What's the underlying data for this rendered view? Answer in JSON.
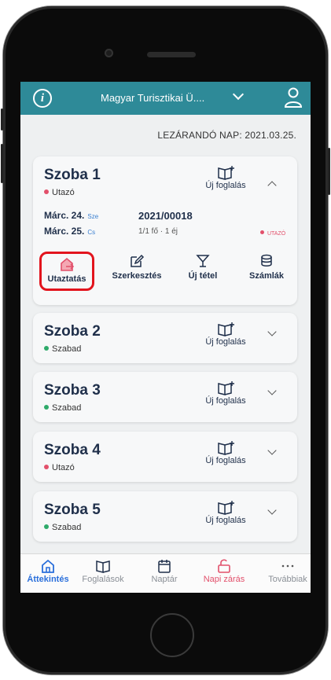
{
  "header": {
    "org_name": "Magyar Turisztikai Ü....",
    "colors": {
      "header_bg": "#2e8a98"
    }
  },
  "close_day": "LEZÁRANDÓ NAP: 2021.03.25.",
  "rooms": [
    {
      "name": "Szoba 1",
      "status": "Utazó",
      "status_color": "#e2506b",
      "booking_label": "Új foglalás",
      "expanded": true,
      "details": {
        "arrival_date": "Márc. 24.",
        "arrival_day": "Sze",
        "departure_date": "Márc. 25.",
        "departure_day": "Cs",
        "booking_number": "2021/00018",
        "guests_nights": "1/1 fő · 1 éj",
        "badge": "UTAZÓ"
      },
      "actions": [
        {
          "label": "Utaztatás",
          "icon": "house-exit-icon",
          "highlighted": true
        },
        {
          "label": "Szerkesztés",
          "icon": "edit-icon"
        },
        {
          "label": "Új tétel",
          "icon": "cocktail-icon"
        },
        {
          "label": "Számlák",
          "icon": "coins-icon"
        }
      ]
    },
    {
      "name": "Szoba 2",
      "status": "Szabad",
      "status_color": "#2eaa6a",
      "booking_label": "Új foglalás"
    },
    {
      "name": "Szoba 3",
      "status": "Szabad",
      "status_color": "#2eaa6a",
      "booking_label": "Új foglalás"
    },
    {
      "name": "Szoba 4",
      "status": "Utazó",
      "status_color": "#e2506b",
      "booking_label": "Új foglalás"
    },
    {
      "name": "Szoba 5",
      "status": "Szabad",
      "status_color": "#2eaa6a",
      "booking_label": "Új foglalás"
    }
  ],
  "tabs": [
    {
      "label": "Áttekintés",
      "icon": "home-icon",
      "active": true,
      "color": "#2a6fdb"
    },
    {
      "label": "Foglalások",
      "icon": "book-icon",
      "color": "#8a8f96"
    },
    {
      "label": "Naptár",
      "icon": "calendar-icon",
      "color": "#8a8f96"
    },
    {
      "label": "Napi zárás",
      "icon": "unlock-icon",
      "color": "#e2506b"
    },
    {
      "label": "Továbbiak",
      "icon": "more-icon",
      "color": "#8a8f96"
    }
  ]
}
